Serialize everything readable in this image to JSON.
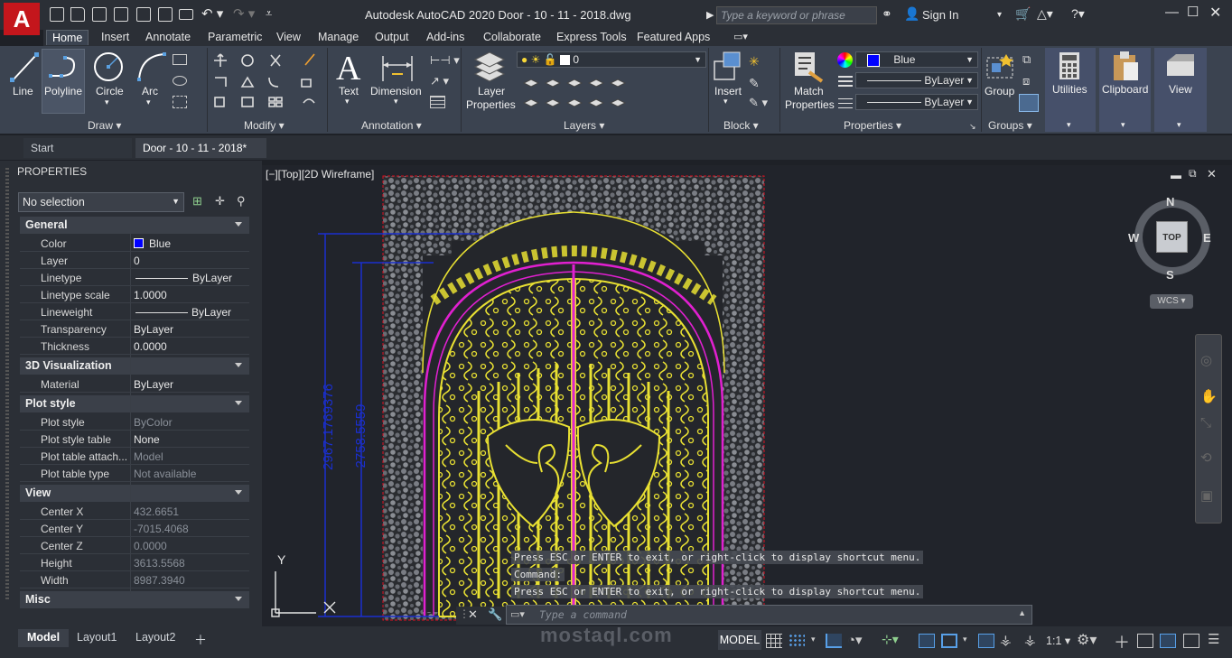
{
  "titlebar": {
    "app_logo": "A",
    "title": "Autodesk AutoCAD 2020    Door - 10 - 11 - 2018.dwg",
    "search_placeholder": "Type a keyword or phrase",
    "sign_in": "Sign In"
  },
  "menubar": {
    "tabs": [
      "Home",
      "Insert",
      "Annotate",
      "Parametric",
      "View",
      "Manage",
      "Output",
      "Add-ins",
      "Collaborate",
      "Express Tools",
      "Featured Apps"
    ],
    "active": "Home"
  },
  "ribbon": {
    "draw": {
      "line": "Line",
      "polyline": "Polyline",
      "circle": "Circle",
      "arc": "Arc",
      "title": "Draw"
    },
    "modify": {
      "title": "Modify"
    },
    "annotation": {
      "text": "Text",
      "dimension": "Dimension",
      "title": "Annotation"
    },
    "layers": {
      "layer_properties": "Layer\nProperties",
      "layer_properties_l1": "Layer",
      "layer_properties_l2": "Properties",
      "current_layer": "0",
      "title": "Layers"
    },
    "block": {
      "insert": "Insert",
      "title": "Block"
    },
    "properties": {
      "match_l1": "Match",
      "match_l2": "Properties",
      "color": "Blue",
      "linetype": "ByLayer",
      "lineweight": "ByLayer",
      "title": "Properties"
    },
    "groups": {
      "group": "Group",
      "title": "Groups"
    },
    "utilities": "Utilities",
    "clipboard": "Clipboard",
    "view": "View"
  },
  "doctabs": {
    "start": "Start",
    "current": "Door - 10 - 11 - 2018*"
  },
  "properties_palette": {
    "title": "PROPERTIES",
    "selection": "No selection",
    "sections": {
      "general": {
        "title": "General",
        "rows": [
          {
            "name": "Color",
            "value": "Blue"
          },
          {
            "name": "Layer",
            "value": "0"
          },
          {
            "name": "Linetype",
            "value": "ByLayer"
          },
          {
            "name": "Linetype scale",
            "value": "1.0000"
          },
          {
            "name": "Lineweight",
            "value": "ByLayer"
          },
          {
            "name": "Transparency",
            "value": "ByLayer"
          },
          {
            "name": "Thickness",
            "value": "0.0000"
          }
        ]
      },
      "visual3d": {
        "title": "3D Visualization",
        "rows": [
          {
            "name": "Material",
            "value": "ByLayer"
          }
        ]
      },
      "plot": {
        "title": "Plot style",
        "rows": [
          {
            "name": "Plot style",
            "value": "ByColor"
          },
          {
            "name": "Plot style table",
            "value": "None"
          },
          {
            "name": "Plot table attach...",
            "value": "Model"
          },
          {
            "name": "Plot table type",
            "value": "Not available"
          }
        ]
      },
      "view": {
        "title": "View",
        "rows": [
          {
            "name": "Center X",
            "value": "432.6651"
          },
          {
            "name": "Center Y",
            "value": "-7015.4068"
          },
          {
            "name": "Center Z",
            "value": "0.0000"
          },
          {
            "name": "Height",
            "value": "3613.5568"
          },
          {
            "name": "Width",
            "value": "8987.3940"
          }
        ]
      },
      "misc": {
        "title": "Misc"
      }
    }
  },
  "viewport": {
    "label": "[−][Top][2D Wireframe]",
    "dim_outer": "2967.1769376",
    "dim_inner": "2758.5559",
    "ucs_y": "Y",
    "ucs_x": "X",
    "viewcube": {
      "top": "TOP",
      "n": "N",
      "s": "S",
      "e": "E",
      "w": "W",
      "wcs": "WCS"
    }
  },
  "command": {
    "history": [
      "Press ESC or ENTER to exit, or right-click to display shortcut menu.",
      "Command:",
      "Press ESC or ENTER to exit, or right-click to display shortcut menu."
    ],
    "placeholder": "Type a command"
  },
  "statusbar": {
    "layouts": [
      "Model",
      "Layout1",
      "Layout2"
    ],
    "model": "MODEL",
    "scale": "1:1",
    "watermark": "mostaql.com"
  },
  "colors": {
    "accent": "#c4161c",
    "dim_blue": "#1a2fd0",
    "door_yellow": "#e8e032",
    "magenta": "#e020d0",
    "border_red": "#e01020"
  }
}
